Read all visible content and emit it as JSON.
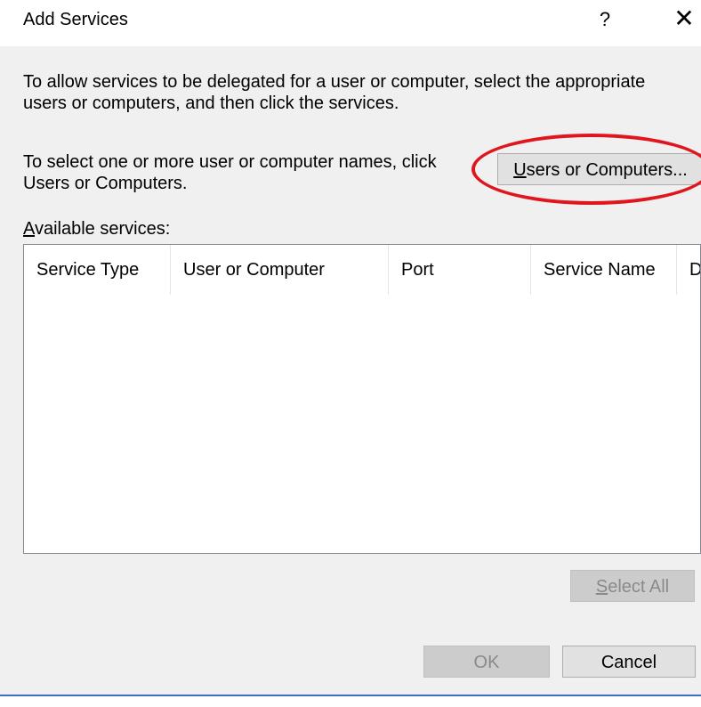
{
  "window": {
    "title": "Add Services",
    "help_glyph": "?",
    "close_glyph": "✕"
  },
  "instructions": {
    "line1": "To allow services to be delegated for a user or computer, select the appropriate",
    "line2": "users or computers, and then click the services.",
    "select_line1": "To select one or more user or computer names, click",
    "select_line2": "Users or Computers."
  },
  "buttons": {
    "users_or_computers_u": "U",
    "users_or_computers_rest": "sers or Computers...",
    "select_all_u": "S",
    "select_all_rest": "elect All",
    "ok": "OK",
    "cancel": "Cancel"
  },
  "available": {
    "label_u": "A",
    "label_rest": "vailable services:",
    "columns": [
      "Service Type",
      "User or Computer",
      "Port",
      "Service Name",
      "D"
    ],
    "rows": []
  },
  "colors": {
    "highlight": "#e0161e",
    "dialog_bg": "#f0f0f0"
  }
}
